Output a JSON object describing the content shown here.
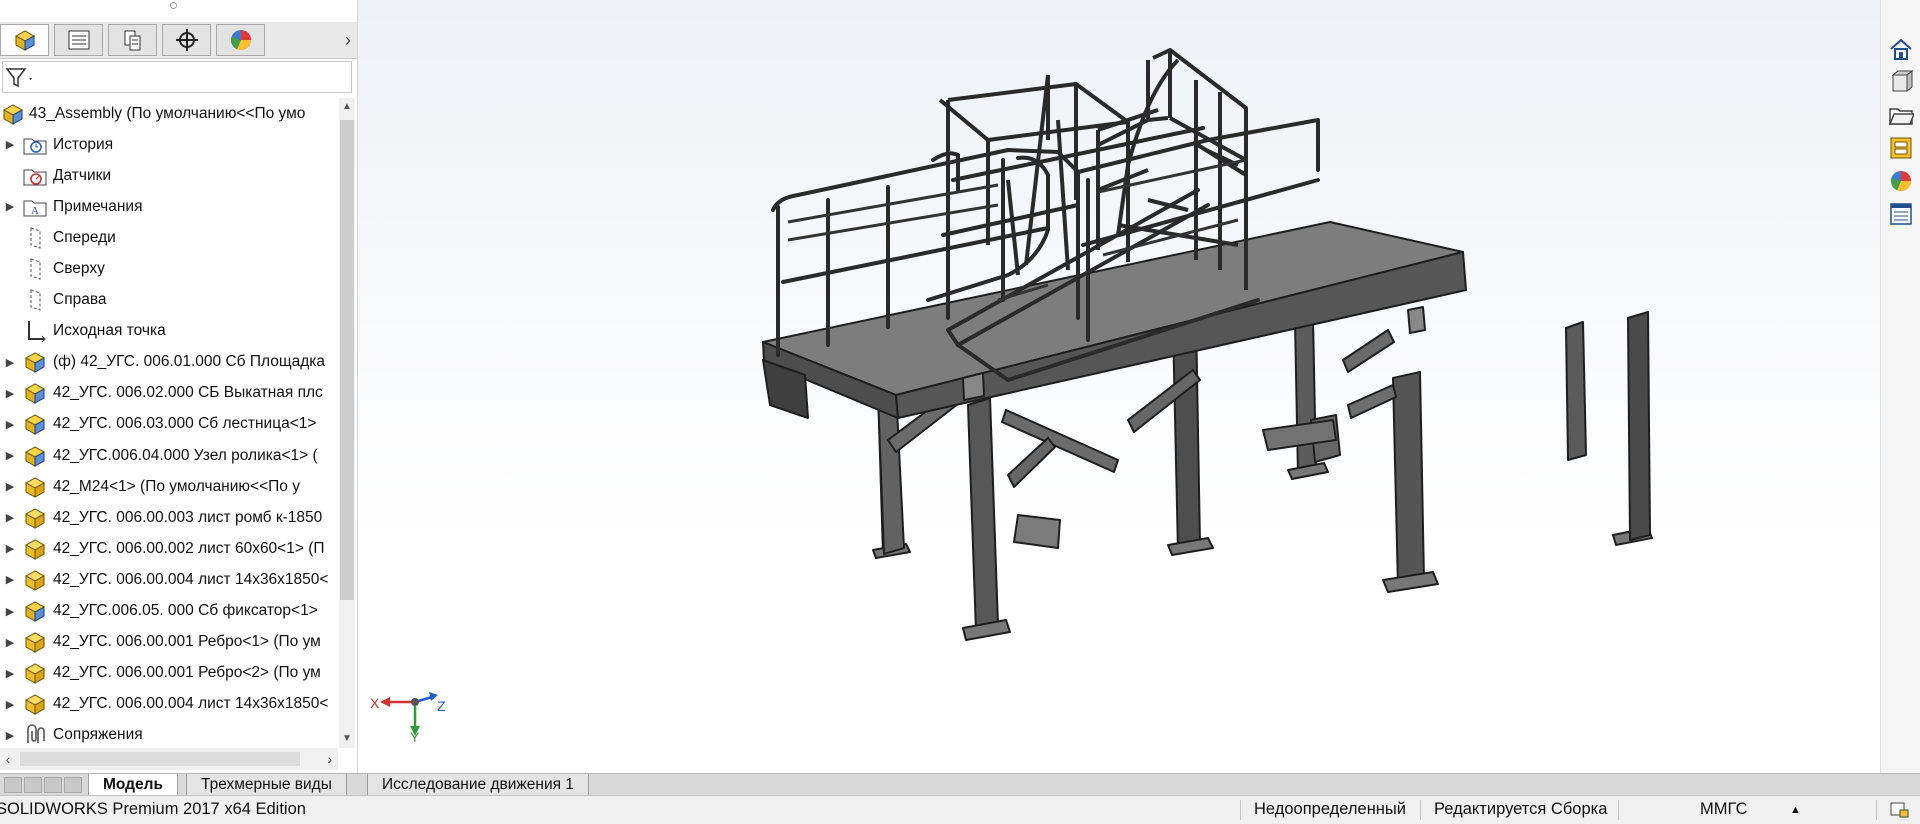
{
  "panel_tabs": [
    {
      "name": "featuremanager-tab",
      "icon": "assembly-cube-icon",
      "active": true
    },
    {
      "name": "propertymanager-tab",
      "icon": "property-list-icon",
      "active": false
    },
    {
      "name": "configurationmanager-tab",
      "icon": "configuration-icon",
      "active": false
    },
    {
      "name": "dimxpert-tab",
      "icon": "crosshair-icon",
      "active": false
    },
    {
      "name": "displaymanager-tab",
      "icon": "color-pie-icon",
      "active": false
    }
  ],
  "tree": {
    "root": "43_Assembly  (По умолчанию<<По умо",
    "items": [
      {
        "label": "История",
        "icon": "history-folder-icon",
        "expandable": true
      },
      {
        "label": "Датчики",
        "icon": "sensor-folder-icon",
        "expandable": false
      },
      {
        "label": "Примечания",
        "icon": "annotations-folder-icon",
        "expandable": true
      },
      {
        "label": "Спереди",
        "icon": "plane-icon",
        "expandable": false
      },
      {
        "label": "Сверху",
        "icon": "plane-icon",
        "expandable": false
      },
      {
        "label": "Справа",
        "icon": "plane-icon",
        "expandable": false
      },
      {
        "label": "Исходная точка",
        "icon": "origin-icon",
        "expandable": false
      },
      {
        "label": "(ф) 42_УГС. 006.01.000 Сб Площадка",
        "icon": "subassembly-icon",
        "expandable": true
      },
      {
        "label": "42_УГС. 006.02.000 СБ Выкатная плс",
        "icon": "subassembly-icon",
        "expandable": true
      },
      {
        "label": "42_УГС. 006.03.000 Сб лестница<1>",
        "icon": "subassembly-icon",
        "expandable": true
      },
      {
        "label": "42_УГС.006.04.000 Узел ролика<1> (",
        "icon": "subassembly-icon",
        "expandable": true
      },
      {
        "label": "42_M24<1> (По умолчанию<<По у",
        "icon": "part-icon",
        "expandable": true
      },
      {
        "label": "42_УГС. 006.00.003 лист ромб к-1850",
        "icon": "part-icon",
        "expandable": true
      },
      {
        "label": "42_УГС. 006.00.002 лист 60x60<1> (П",
        "icon": "part-icon",
        "expandable": true
      },
      {
        "label": "42_УГС. 006.00.004 лист 14x36x1850<",
        "icon": "part-icon",
        "expandable": true
      },
      {
        "label": "42_УГС.006.05. 000 Сб фиксатор<1>",
        "icon": "subassembly-icon",
        "expandable": true
      },
      {
        "label": "42_УГС. 006.00.001 Ребро<1> (По ум",
        "icon": "part-icon",
        "expandable": true
      },
      {
        "label": "42_УГС. 006.00.001 Ребро<2> (По ум",
        "icon": "part-icon",
        "expandable": true
      },
      {
        "label": "42_УГС. 006.00.004 лист 14x36x1850<",
        "icon": "part-icon",
        "expandable": true
      },
      {
        "label": "Сопряжения",
        "icon": "mates-icon",
        "expandable": true
      }
    ]
  },
  "triad": {
    "x": "X",
    "y": "Y",
    "z": "Z"
  },
  "right_toolbar": [
    "home-icon",
    "3d-parts-icon",
    "file-explorer-icon",
    "view-palette-icon",
    "appearances-icon",
    "custom-properties-icon"
  ],
  "bottom_tabs": [
    "Модель",
    "Трехмерные виды",
    "Исследование движения 1"
  ],
  "status": {
    "app": "SOLIDWORKS Premium 2017 x64 Edition",
    "definition": "Недоопределенный",
    "mode": "Редактируется Сборка",
    "units": "ММГС"
  },
  "colors": {
    "steel_face": "#5f5f5f",
    "steel_edge": "#1e1e1e",
    "part_yellow": "#f2c230",
    "accent_blue": "#2b6cc4"
  }
}
